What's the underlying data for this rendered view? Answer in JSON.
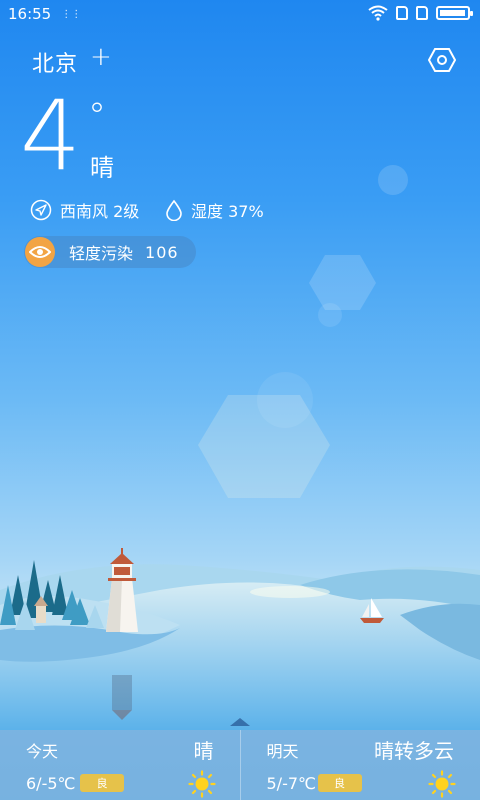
{
  "status_bar": {
    "time": "16:55",
    "battery_level": 0.95
  },
  "header": {
    "city": "北京",
    "add_symbol": "+"
  },
  "current": {
    "temperature": "4",
    "degree_symbol": "°",
    "condition": "晴",
    "wind": "西南风 2级",
    "humidity": "湿度 37%"
  },
  "air_quality": {
    "label": "轻度污染",
    "value": "106",
    "color": "#f2a444"
  },
  "forecast": [
    {
      "day": "今天",
      "condition": "晴",
      "temp": "6/-5℃",
      "aqi": "良",
      "icon": "sun-icon"
    },
    {
      "day": "明天",
      "condition": "晴转多云",
      "temp": "5/-7℃",
      "aqi": "良",
      "icon": "sun-icon"
    }
  ],
  "colors": {
    "sun": "#ffd21f",
    "aqi_badge": "#e6c24a",
    "sky_top": "#1f87f0"
  }
}
